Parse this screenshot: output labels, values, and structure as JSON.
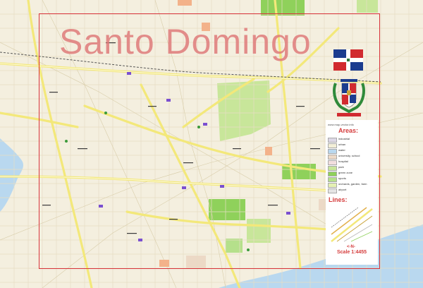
{
  "map": {
    "title": "Santo Domingo",
    "url": "www.map-vector.info",
    "legend_areas_heading": "Areas:",
    "legend_lines_heading": "Lines:",
    "legend_areas": [
      {
        "label": "industrial",
        "color": "#ddd8e6"
      },
      {
        "label": "urban",
        "color": "#f3efd8"
      },
      {
        "label": "water",
        "color": "#b9d8ef"
      },
      {
        "label": "university, school",
        "color": "#ecd9c6"
      },
      {
        "label": "hospital",
        "color": "#f2dede"
      },
      {
        "label": "park",
        "color": "#c8e69a"
      },
      {
        "label": "green zone",
        "color": "#8fd15b"
      },
      {
        "label": "sports",
        "color": "#b5e08b"
      },
      {
        "label": "orchards, garden, farm",
        "color": "#e4f0b3"
      },
      {
        "label": "airport",
        "color": "#e5e5e5"
      }
    ],
    "scale": "Scale 1:4455",
    "north_arrow": "<-N-",
    "colors": {
      "frame": "#d8343c",
      "title": "#de7676",
      "background": "#f4efdf",
      "major_road": "#f3e87a",
      "water": "#b9d8ef",
      "park": "#c8e69a"
    }
  }
}
